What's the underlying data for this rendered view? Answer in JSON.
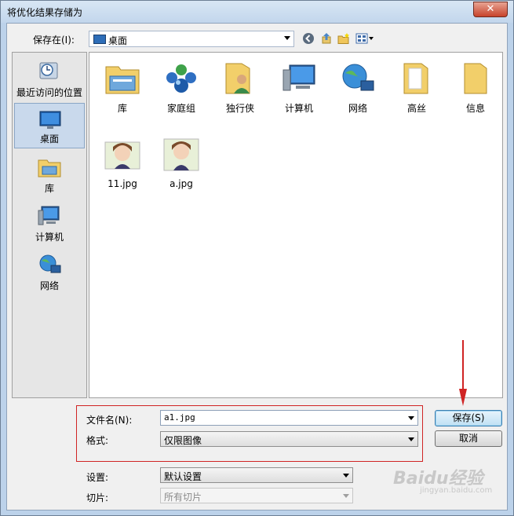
{
  "window": {
    "title": "将优化结果存储为",
    "close_glyph": "✕"
  },
  "toolbar": {
    "save_in_label": "保存在(I):",
    "location": "桌面"
  },
  "places": [
    {
      "label": "最近访问的位置",
      "icon": "recent-places-icon"
    },
    {
      "label": "桌面",
      "icon": "desktop-icon",
      "selected": true
    },
    {
      "label": "库",
      "icon": "library-icon"
    },
    {
      "label": "计算机",
      "icon": "computer-icon"
    },
    {
      "label": "网络",
      "icon": "network-icon"
    }
  ],
  "files": [
    {
      "label": "库",
      "icon": "library-icon"
    },
    {
      "label": "家庭组",
      "icon": "homegroup-icon"
    },
    {
      "label": "独行侠",
      "icon": "user-folder-icon"
    },
    {
      "label": "计算机",
      "icon": "computer-icon"
    },
    {
      "label": "网络",
      "icon": "network-icon"
    },
    {
      "label": "高丝",
      "icon": "folder-icon"
    },
    {
      "label": "信息",
      "icon": "folder-icon"
    },
    {
      "label": "11.jpg",
      "icon": "image-thumbnail-icon"
    },
    {
      "label": "a.jpg",
      "icon": "image-thumbnail-icon"
    }
  ],
  "form": {
    "filename_label": "文件名(N):",
    "filename_value": "a1.jpg",
    "format_label": "格式:",
    "format_value": "仅限图像",
    "settings_label": "设置:",
    "settings_value": "默认设置",
    "slices_label": "切片:",
    "slices_value": "所有切片"
  },
  "buttons": {
    "save": "保存(S)",
    "cancel": "取消"
  },
  "watermark": {
    "brand": "Baidu经验",
    "url": "jingyan.baidu.com"
  },
  "colors": {
    "annotation_red": "#d02424",
    "title_bar": "#c2d6ec",
    "close_red": "#c7432b"
  }
}
